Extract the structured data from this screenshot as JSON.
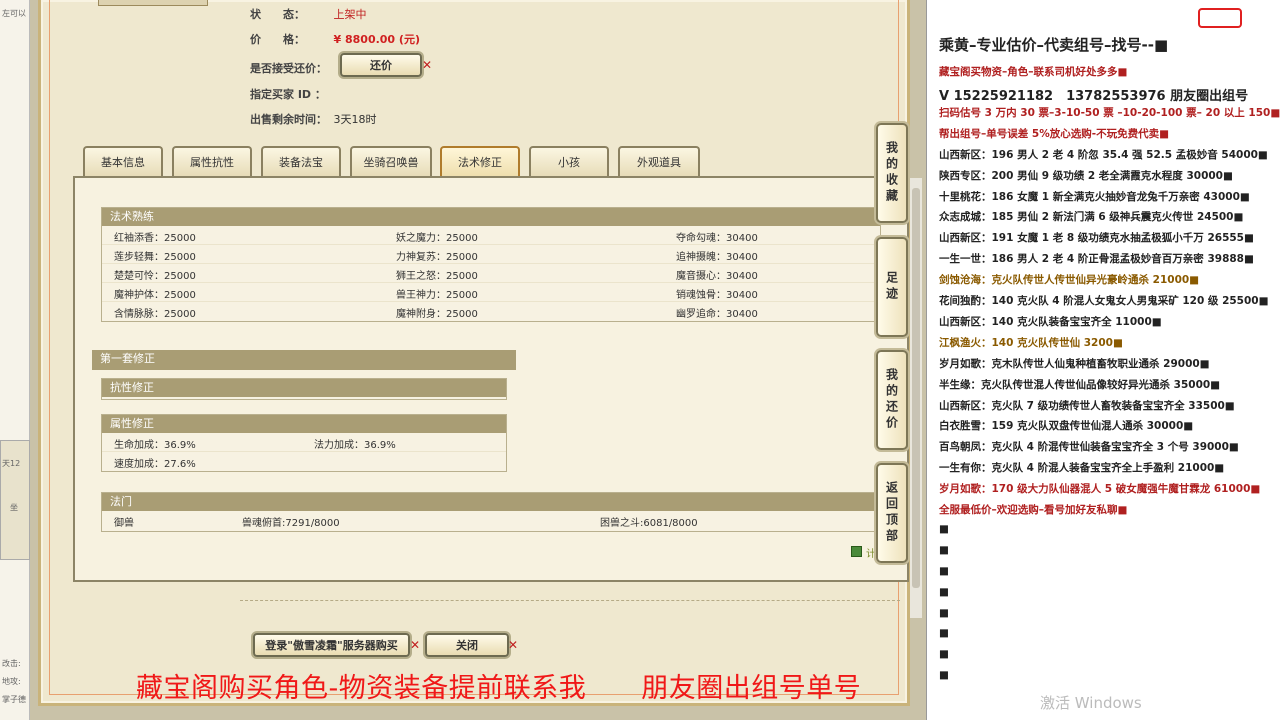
{
  "left_strip": {
    "labels": [
      "左可以",
      "天12",
      "坐",
      "改击:",
      "地攻:",
      "掌子德"
    ]
  },
  "status": {
    "label": "状　　态：",
    "value": "上架中"
  },
  "price": {
    "label": "价　　格：",
    "value": "¥ 8800.00 (元)"
  },
  "bargain": {
    "label": "是否接受还价：",
    "button": "还价"
  },
  "buyer": {
    "label": "指定买家 ID ："
  },
  "time_left": {
    "label": "出售剩余时间：",
    "value": "3天18时"
  },
  "tabs": [
    {
      "label": "基本信息"
    },
    {
      "label": "属性抗性"
    },
    {
      "label": "装备法宝"
    },
    {
      "label": "坐骑召唤兽"
    },
    {
      "label": "法术修正"
    },
    {
      "label": "小孩"
    },
    {
      "label": "外观道具"
    }
  ],
  "spell_training": {
    "title": "法术熟练",
    "rows": [
      [
        "红袖添香：25000",
        "妖之魔力：25000",
        "夺命勾魂：30400"
      ],
      [
        "莲步轻舞：25000",
        "力神复苏：25000",
        "追神摄魄：30400"
      ],
      [
        "楚楚可怜：25000",
        "狮王之怒：25000",
        "魔音摄心：30400"
      ],
      [
        "魔神护体：25000",
        "兽王神力：25000",
        "销魂蚀骨：30400"
      ],
      [
        "含情脉脉：25000",
        "魔神附身：25000",
        "幽罗追命：30400"
      ]
    ]
  },
  "first_set": {
    "title": "第一套修正"
  },
  "resist": {
    "title": "抗性修正"
  },
  "attribute": {
    "title": "属性修正",
    "rows": [
      [
        "生命加成：36.9%",
        "法力加成：36.9%"
      ],
      [
        "速度加成：27.6%"
      ]
    ]
  },
  "magic": {
    "title": "法门",
    "cols": [
      "御兽",
      "兽魂俯首:7291/8000",
      "困兽之斗:6081/8000"
    ]
  },
  "calc": {
    "label": "计"
  },
  "bottom_buttons": {
    "login": "登录\"傲雪凌霜\"服务器购买",
    "close": "关闭"
  },
  "side_buttons": [
    {
      "label": "我的收藏"
    },
    {
      "label": "足迹"
    },
    {
      "label": "我的还价"
    },
    {
      "label": "返回顶部"
    }
  ],
  "notepad": {
    "lines": [
      {
        "text": "乘黄–专业估价–代卖组号–找号--■",
        "style": "big"
      },
      {
        "text": "藏宝阁买物资–角色–联系司机好处多多■",
        "style": "red"
      },
      {
        "text": "V 15225921182　13782553976 朋友圈出组号",
        "style": "big2"
      },
      {
        "text": "扫码估号 3 万内 30 票–3-10-50 票 –10-20-100 票– 20 以上 150■",
        "style": "red"
      },
      {
        "text": "帮出组号–单号误差 5%放心选购-不玩免费代卖■",
        "style": "red"
      },
      {
        "text": "山西新区：196 男人 2 老 4 阶忽 35.4 强 52.5 孟极妙音 54000■",
        "style": ""
      },
      {
        "text": "陕西专区：200 男仙 9 级功绩 2 老全满霞克水程度 30000■",
        "style": ""
      },
      {
        "text": "十里桃花：186 女魔 1 新全满克火抽妙音龙兔千万亲密 43000■",
        "style": ""
      },
      {
        "text": "众志成城：185 男仙 2 新法门满 6 级神兵震克火传世 24500■",
        "style": ""
      },
      {
        "text": "山西新区：191 女魔 1 老 8 级功绩克水抽孟极狐小千万 26555■",
        "style": ""
      },
      {
        "text": "一生一世：186 男人 2 老 4 阶正骨混孟极妙音百万亲密 39888■",
        "style": ""
      },
      {
        "text": "剑蚀沧海：克火队传世人传世仙异光豪岭通杀 21000■",
        "style": "gold"
      },
      {
        "text": "花间独酌：140 克火队 4 阶混人女鬼女人男鬼采矿 120 级 25500■",
        "style": ""
      },
      {
        "text": "山西新区：140 克火队装备宝宝齐全 11000■",
        "style": ""
      },
      {
        "text": "江枫渔火：140 克火队传世仙 3200■",
        "style": "gold"
      },
      {
        "text": "岁月如歌：克木队传世人仙鬼种植畜牧职业通杀 29000■",
        "style": ""
      },
      {
        "text": "半生缘：克火队传世混人传世仙品像较好异光通杀 35000■",
        "style": ""
      },
      {
        "text": "山西新区：克火队 7 级功绩传世人畜牧装备宝宝齐全 33500■",
        "style": ""
      },
      {
        "text": "白衣胜雪：159 克火队双盘传世仙混人通杀 30000■",
        "style": ""
      },
      {
        "text": "百鸟朝凤：克火队 4 阶混传世仙装备宝宝齐全 3 个号 39000■",
        "style": ""
      },
      {
        "text": "一生有你：克火队 4 阶混人装备宝宝齐全上手盈利 21000■",
        "style": ""
      },
      {
        "text": "岁月如歌：170 级大力队仙器混人 5 破女魔强牛魔甘霖龙 61000■",
        "style": "red"
      },
      {
        "text": "全服最低价–欢迎选购–看号加好友私聊■",
        "style": "red"
      },
      {
        "text": "■",
        "style": ""
      },
      {
        "text": "■",
        "style": ""
      },
      {
        "text": "■",
        "style": ""
      },
      {
        "text": "■",
        "style": ""
      },
      {
        "text": "■",
        "style": ""
      },
      {
        "text": "■",
        "style": ""
      },
      {
        "text": "■",
        "style": ""
      },
      {
        "text": "■",
        "style": ""
      }
    ]
  },
  "overlay": {
    "text": "藏宝阁购买角色-物资装备提前联系我　　朋友圈出组号单号"
  },
  "watermark": {
    "text": "激活 Windows"
  },
  "colors": {
    "price_red": "#d02020",
    "overlay_red": "#f01818",
    "section_head": "#a99d74",
    "frame_border": "#c9b37a"
  }
}
